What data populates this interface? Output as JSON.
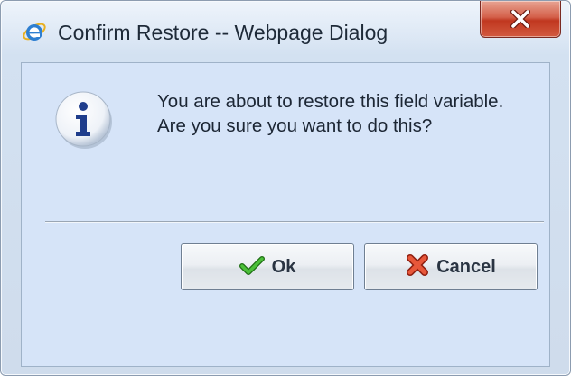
{
  "window": {
    "title": "Confirm Restore -- Webpage Dialog",
    "title_icon": "internet-explorer-icon",
    "close_icon": "close-icon"
  },
  "dialog": {
    "icon": "info-icon",
    "message_line1": "You are about to restore this field variable.",
    "message_line2": "Are you sure you want to do this?"
  },
  "buttons": {
    "ok_label": "Ok",
    "ok_icon": "checkmark-icon",
    "cancel_label": "Cancel",
    "cancel_icon": "x-icon"
  },
  "colors": {
    "client_background": "#d6e4f8",
    "close_button": "#c0371f",
    "info_icon": "#1f3d8c",
    "checkmark": "#2e9a1e",
    "cancel_x": "#d8442b"
  }
}
